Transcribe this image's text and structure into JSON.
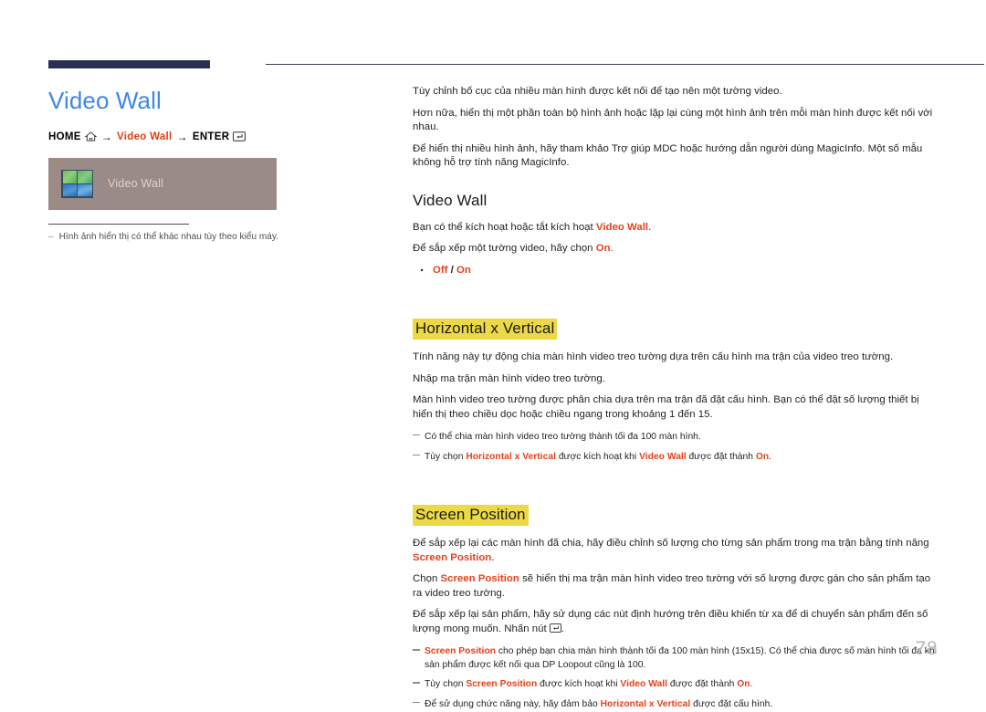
{
  "colors": {
    "title_blue": "#3d87e8",
    "accent_orange": "#e8401b",
    "highlight_yellow": "#ecd945",
    "rule_navy": "#2b3053",
    "panel_mauve": "#9b8b86",
    "page_number_gray": "#b6b6b6"
  },
  "left": {
    "page_title": "Video Wall",
    "breadcrumb": {
      "home_label": "HOME",
      "home_icon": "home-icon",
      "arrow": "→",
      "middle_label": "Video Wall",
      "enter_label": "ENTER",
      "enter_icon": "enter-key-icon"
    },
    "image_panel": {
      "icon": "video-wall-grid-icon",
      "label": "Video Wall"
    },
    "caption": "Hình ảnh hiển thị có thể khác nhau tùy theo kiểu máy."
  },
  "intro": {
    "p1": "Tùy chỉnh bố cục của nhiều màn hình được kết nối để tạo nên một tường video.",
    "p2": "Hơn nữa, hiển thị một phần toàn bộ hình ảnh hoặc lặp lại cùng một hình ảnh trên mỗi màn hình được kết nối với nhau.",
    "p3": "Để hiển thị nhiều hình ảnh, hãy tham khảo Trợ giúp MDC hoặc hướng dẫn người dùng MagicInfo. Một số mẫu không hỗ trợ tính năng MagicInfo."
  },
  "section_video_wall": {
    "heading": "Video Wall",
    "p1_before": "Bạn có thể kích hoạt hoặc tắt kích hoạt ",
    "p1_accent": "Video Wall",
    "p1_after": ".",
    "p2_before": "Để sắp xếp một tường video, hãy chọn ",
    "p2_accent": "On",
    "p2_after": ".",
    "option_off": "Off",
    "option_sep": " / ",
    "option_on": "On"
  },
  "section_hxv": {
    "heading": "Horizontal x Vertical",
    "p1": "Tính năng này tự động chia màn hình video treo tường dựa trên cấu hình ma trận của video treo tường.",
    "p2": "Nhập ma trận màn hình video treo tường.",
    "p3": "Màn hình video treo tường được phân chia dựa trên ma trận đã đặt cấu hình. Bạn có thể đặt số lượng thiết bị hiển thị theo chiều dọc hoặc chiều ngang trong khoảng 1 đến 15.",
    "note1": "Có thể chia màn hình video treo tường thành tối đa 100 màn hình.",
    "note2_a": "Tùy chọn ",
    "note2_accent1": "Horizontal x Vertical",
    "note2_b": " được kích hoạt khi ",
    "note2_accent2": "Video Wall",
    "note2_c": " được đặt thành ",
    "note2_accent3": "On",
    "note2_d": "."
  },
  "section_screen_position": {
    "heading": "Screen Position",
    "p1_before": "Để sắp xếp lại các màn hình đã chia, hãy điều chỉnh số lượng cho từng sản phẩm trong ma trận bằng tính năng ",
    "p1_accent": "Screen Position",
    "p1_after": ".",
    "p2_before": "Chọn ",
    "p2_accent": "Screen Position",
    "p2_after": " sẽ hiển thị ma trận màn hình video treo tường với số lượng được gán cho sản phẩm tạo ra video treo tường.",
    "p3_before": "Để sắp xếp lại sản phẩm, hãy sử dụng các nút định hướng trên điều khiển từ xa để di chuyển sản phẩm đến số lượng mong muốn. Nhấn nút ",
    "p3_after": ".",
    "note1_accent": "Screen Position",
    "note1_text": " cho phép bạn chia màn hình thành tối đa 100 màn hình (15x15). Có thể chia được số màn hình tối đa khi sản phẩm được kết nối qua DP Loopout cũng là 100.",
    "note2_a": "Tùy chọn ",
    "note2_accent1": "Screen Position",
    "note2_b": " được kích hoạt khi ",
    "note2_accent2": "Video Wall",
    "note2_c": " được đặt thành ",
    "note2_accent3": "On",
    "note2_d": ".",
    "note3_a": "Để sử dụng chức năng này, hãy đảm bảo ",
    "note3_accent": "Horizontal x Vertical",
    "note3_b": " được đặt cấu hình."
  },
  "footer": {
    "page_number": "78"
  }
}
